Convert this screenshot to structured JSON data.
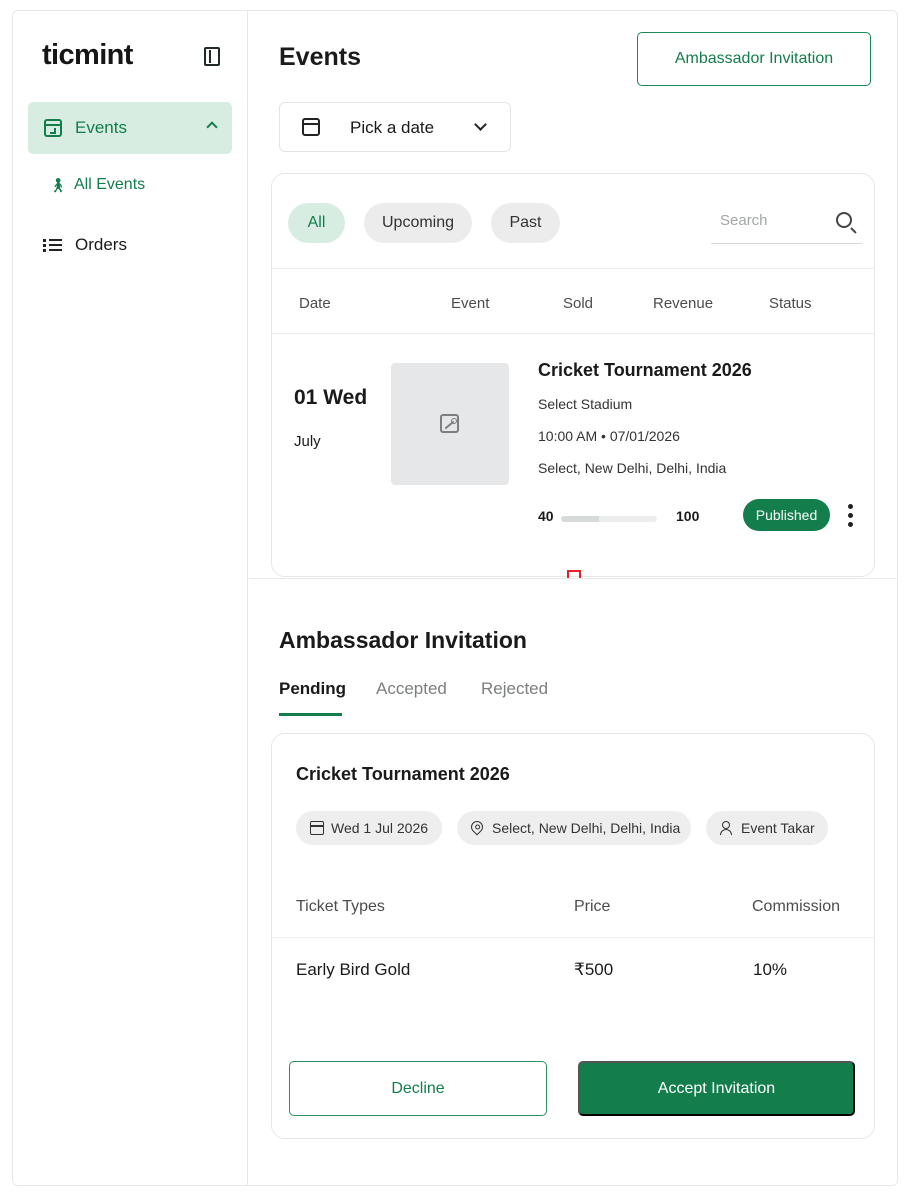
{
  "brand": {
    "logo": "ticmint",
    "accent": "#137d4c",
    "accent_light": "#d8ede2"
  },
  "sidebar": {
    "items": [
      {
        "label": "Events",
        "icon": "calendar-icon",
        "expanded": true,
        "active": true
      },
      {
        "label": "All Events",
        "icon": "walking-icon",
        "sub": true
      },
      {
        "label": "Orders",
        "icon": "list-icon"
      }
    ]
  },
  "header": {
    "title": "Events",
    "ambassador_button": "Ambassador Invitation"
  },
  "date_picker": {
    "label": "Pick a date"
  },
  "events": {
    "filters": [
      "All",
      "Upcoming",
      "Past"
    ],
    "active_filter": "All",
    "search_placeholder": "Search",
    "columns": [
      "Date",
      "Event",
      "Sold",
      "Revenue",
      "Status"
    ],
    "rows": [
      {
        "day": "01 Wed",
        "month": "July",
        "name": "Cricket Tournament 2026",
        "venue": "Select Stadium",
        "datetime": "10:00 AM • 07/01/2026",
        "location": "Select, New Delhi, Delhi, India",
        "sold": "40",
        "capacity": "100",
        "sold_fraction": 0.4,
        "status": "Published"
      }
    ]
  },
  "ambassador": {
    "title": "Ambassador Invitation",
    "tabs": [
      "Pending",
      "Accepted",
      "Rejected"
    ],
    "active_tab": "Pending",
    "invitation": {
      "name": "Cricket Tournament 2026",
      "date": "Wed 1 Jul 2026",
      "location": "Select, New Delhi, Delhi, India",
      "organizer": "Event Takar",
      "ticket_columns": [
        "Ticket Types",
        "Price",
        "Commission"
      ],
      "tickets": [
        {
          "type": "Early Bird Gold",
          "price": "₹500",
          "commission": "10%"
        }
      ],
      "decline_label": "Decline",
      "accept_label": "Accept Invitation"
    }
  }
}
